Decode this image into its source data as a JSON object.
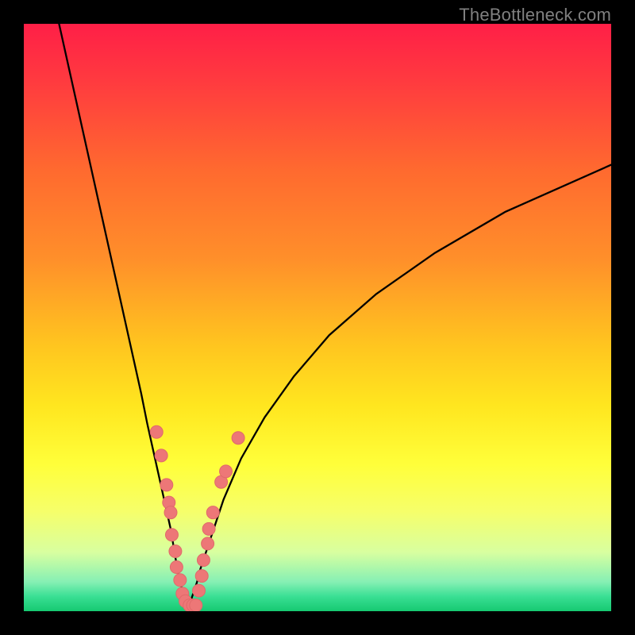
{
  "watermark": "TheBottleneck.com",
  "colors": {
    "frame": "#000000",
    "curve": "#000000",
    "dot_fill": "#ed7777",
    "dot_stroke": "#e06a6a",
    "watermark": "#808080",
    "gradient_stops": [
      {
        "offset": 0.0,
        "color": "#ff1f47"
      },
      {
        "offset": 0.1,
        "color": "#ff3b3f"
      },
      {
        "offset": 0.25,
        "color": "#ff6a2f"
      },
      {
        "offset": 0.4,
        "color": "#ff8f2a"
      },
      {
        "offset": 0.55,
        "color": "#ffc61f"
      },
      {
        "offset": 0.65,
        "color": "#ffe61f"
      },
      {
        "offset": 0.75,
        "color": "#ffff3a"
      },
      {
        "offset": 0.83,
        "color": "#f6ff6a"
      },
      {
        "offset": 0.9,
        "color": "#d8ffa0"
      },
      {
        "offset": 0.95,
        "color": "#86f0b4"
      },
      {
        "offset": 0.975,
        "color": "#3adf94"
      },
      {
        "offset": 1.0,
        "color": "#16c971"
      }
    ]
  },
  "chart_data": {
    "type": "line",
    "title": "",
    "xlabel": "",
    "ylabel": "",
    "xlim": [
      0,
      100
    ],
    "ylim": [
      0,
      100
    ],
    "series": [
      {
        "name": "bottleneck-curve-left",
        "x": [
          6,
          8,
          10,
          12,
          14,
          16,
          18,
          20,
          21,
          22,
          23,
          24,
          25,
          25.5,
          26,
          26.5,
          27,
          27.5,
          28
        ],
        "y": [
          100,
          91,
          82,
          73,
          64,
          55,
          46,
          37,
          32,
          27.5,
          23,
          18.5,
          14,
          11,
          8,
          5.5,
          3.5,
          2,
          1
        ]
      },
      {
        "name": "bottleneck-curve-right",
        "x": [
          28,
          28.5,
          29,
          29.5,
          30,
          31,
          32,
          34,
          37,
          41,
          46,
          52,
          60,
          70,
          82,
          100
        ],
        "y": [
          1,
          2,
          3.5,
          5,
          7,
          10,
          13,
          19,
          26,
          33,
          40,
          47,
          54,
          61,
          68,
          76
        ]
      }
    ],
    "scatter": {
      "name": "data-points",
      "points": [
        {
          "x": 22.6,
          "y": 30.5
        },
        {
          "x": 23.4,
          "y": 26.5
        },
        {
          "x": 24.3,
          "y": 21.5
        },
        {
          "x": 24.7,
          "y": 18.5
        },
        {
          "x": 25.0,
          "y": 16.8
        },
        {
          "x": 25.2,
          "y": 13.0
        },
        {
          "x": 25.8,
          "y": 10.2
        },
        {
          "x": 26.0,
          "y": 7.5
        },
        {
          "x": 26.6,
          "y": 5.3
        },
        {
          "x": 27.0,
          "y": 3.0
        },
        {
          "x": 27.5,
          "y": 1.7
        },
        {
          "x": 28.2,
          "y": 1.0
        },
        {
          "x": 28.8,
          "y": 1.0
        },
        {
          "x": 29.3,
          "y": 1.0
        },
        {
          "x": 29.8,
          "y": 3.5
        },
        {
          "x": 30.3,
          "y": 6.0
        },
        {
          "x": 30.6,
          "y": 8.7
        },
        {
          "x": 31.3,
          "y": 11.5
        },
        {
          "x": 31.5,
          "y": 14.0
        },
        {
          "x": 32.2,
          "y": 16.8
        },
        {
          "x": 33.6,
          "y": 22.0
        },
        {
          "x": 34.4,
          "y": 23.8
        },
        {
          "x": 36.5,
          "y": 29.5
        }
      ]
    }
  }
}
